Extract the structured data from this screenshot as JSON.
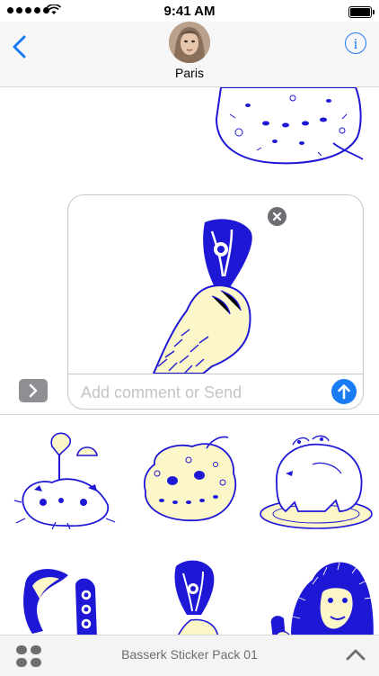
{
  "status_bar": {
    "time": "9:41 AM",
    "signal_dots": 5
  },
  "header": {
    "contact_name": "Paris"
  },
  "composer": {
    "placeholder": "Add comment or Send"
  },
  "sticker_pack": {
    "title": "Basserk Sticker Pack 01"
  },
  "colors": {
    "accent": "#1a7cf5",
    "sticker_ink": "#1f17d6",
    "sticker_fill": "#fbf7c8"
  },
  "icons": [
    "wifi-icon",
    "battery-icon",
    "back-chevron-icon",
    "info-icon",
    "remove-icon",
    "send-arrow-icon",
    "expand-chevron-icon",
    "app-drawer-icon",
    "chevron-up-icon"
  ]
}
